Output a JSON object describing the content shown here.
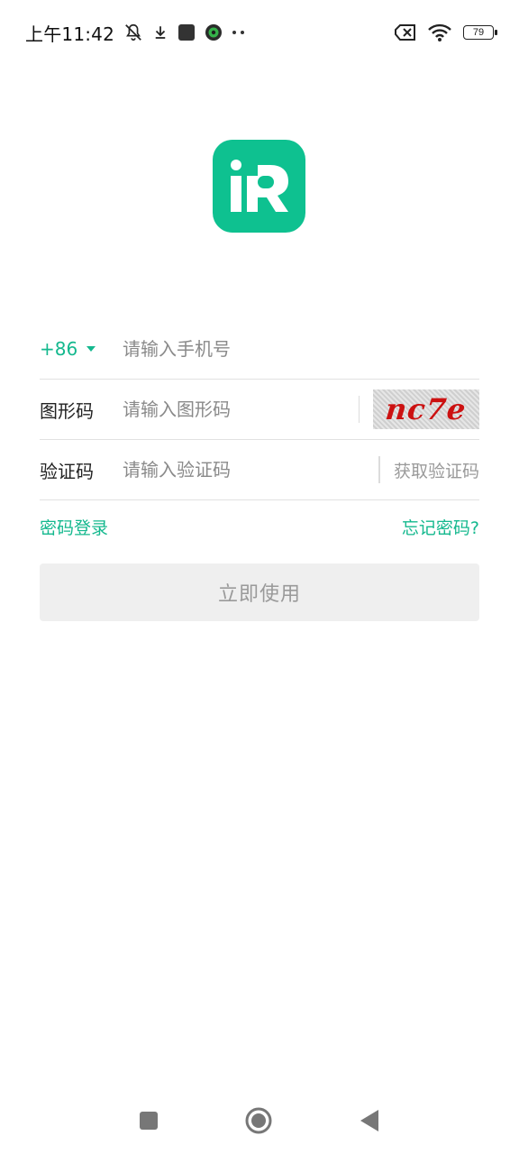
{
  "status_bar": {
    "time": "上午11:42",
    "battery": "79",
    "icons": [
      "mute-icon",
      "download-icon",
      "app-square-icon",
      "app-badge-icon",
      "more-dots-icon",
      "sim-off-icon",
      "wifi-icon",
      "battery-icon"
    ]
  },
  "app": {
    "logo_text": "iR",
    "logo_color": "#0ec190",
    "accent_color": "#14b88e"
  },
  "form": {
    "country_code": "+86",
    "phone_placeholder": "请输入手机号",
    "captcha_label": "图形码",
    "captcha_placeholder": "请输入图形码",
    "captcha_image_text": "nc7e",
    "code_label": "验证码",
    "code_placeholder": "请输入验证码",
    "get_code_label": "获取验证码"
  },
  "links": {
    "password_login": "密码登录",
    "forgot_password": "忘记密码?"
  },
  "submit_label": "立即使用",
  "nav_bar": {
    "buttons": [
      "recents-button",
      "home-button",
      "back-button"
    ]
  }
}
